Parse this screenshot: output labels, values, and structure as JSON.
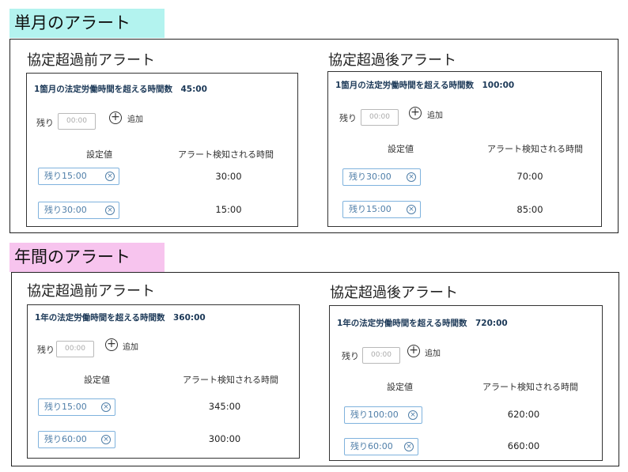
{
  "sections": {
    "monthly": {
      "title": "単月のアラート",
      "before": {
        "heading": "協定超過前アラート",
        "limit_label": "1箇月の法定労働時間を超える時間数　45:00",
        "remain_label": "残り",
        "remain_placeholder": "00:00",
        "add_label": "追加",
        "col_setting": "設定値",
        "col_alert": "アラート検知される時間",
        "rows": [
          {
            "setting": "残り15:00",
            "alert": "30:00"
          },
          {
            "setting": "残り30:00",
            "alert": "15:00"
          }
        ]
      },
      "after": {
        "heading": "協定超過後アラート",
        "limit_label": "1箇月の法定労働時間を超える時間数　100:00",
        "remain_label": "残り",
        "remain_placeholder": "00:00",
        "add_label": "追加",
        "col_setting": "設定値",
        "col_alert": "アラート検知される時間",
        "rows": [
          {
            "setting": "残り30:00",
            "alert": "70:00"
          },
          {
            "setting": "残り15:00",
            "alert": "85:00"
          }
        ]
      }
    },
    "yearly": {
      "title": "年間のアラート",
      "before": {
        "heading": "協定超過前アラート",
        "limit_label": "1年の法定労働時間を超える時間数　360:00",
        "remain_label": "残り",
        "remain_placeholder": "00:00",
        "add_label": "追加",
        "col_setting": "設定値",
        "col_alert": "アラート検知される時間",
        "rows": [
          {
            "setting": "残り15:00",
            "alert": "345:00"
          },
          {
            "setting": "残り60:00",
            "alert": "300:00"
          }
        ]
      },
      "after": {
        "heading": "協定超過後アラート",
        "limit_label": "1年の法定労働時間を超える時間数　720:00",
        "remain_label": "残り",
        "remain_placeholder": "00:00",
        "add_label": "追加",
        "col_setting": "設定値",
        "col_alert": "アラート検知される時間",
        "rows": [
          {
            "setting": "残り100:00",
            "alert": "620:00"
          },
          {
            "setting": "残り60:00",
            "alert": "660:00"
          }
        ]
      }
    }
  },
  "icons": {
    "add": "plus-circle-icon",
    "remove": "close-circle-icon"
  },
  "colors": {
    "monthly_title_bg": "#b3f3ef",
    "yearly_title_bg": "#f7c4ee",
    "chip_border": "#7fb2dd",
    "limit_text": "#1b3857"
  }
}
